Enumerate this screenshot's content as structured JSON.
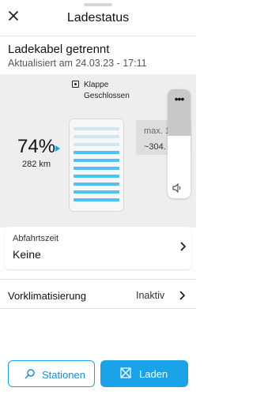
{
  "header": {
    "title": "Ladestatus",
    "close_icon": "close-icon"
  },
  "status": {
    "main": "Ladekabel getrennt",
    "updated": "Aktualisiert am 24.03.23 - 17:11"
  },
  "flap": {
    "label": "Klappe",
    "state": "Geschlossen",
    "icon": "flap-icon"
  },
  "battery": {
    "soc": "74%",
    "soc_value": 74,
    "range": "282 km",
    "bars_total": 10,
    "bars_filled": 7
  },
  "max_box": {
    "label": "max. 1",
    "suffix": "%",
    "range": "~304."
  },
  "volume_overlay": {
    "dots": "•••",
    "level": 0.57,
    "icon": "speaker-icon"
  },
  "departure": {
    "label": "Abfahrtszeit",
    "value": "Keine"
  },
  "preconditioning": {
    "label": "Vorklimatisierung",
    "value": "Inaktiv"
  },
  "buttons": {
    "stations": "Stationen",
    "charge": "Laden"
  },
  "colors": {
    "accent": "#1aa3e8",
    "bar_empty": "#cfe6f3",
    "bar_filled": "#4fc2f5"
  }
}
